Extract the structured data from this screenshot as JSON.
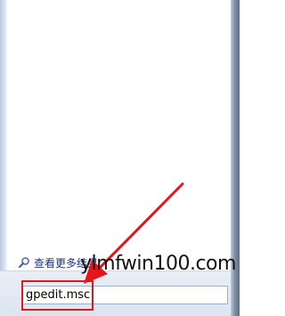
{
  "start_menu": {
    "see_more_results_label": "查看更多结果",
    "see_more_icon": "search-icon",
    "search_value": "gpedit.msc"
  },
  "annotation": {
    "highlight_color": "#e8141c",
    "arrow_color": "#e8141c"
  },
  "watermark": {
    "text": "ylmfwin100.com"
  }
}
